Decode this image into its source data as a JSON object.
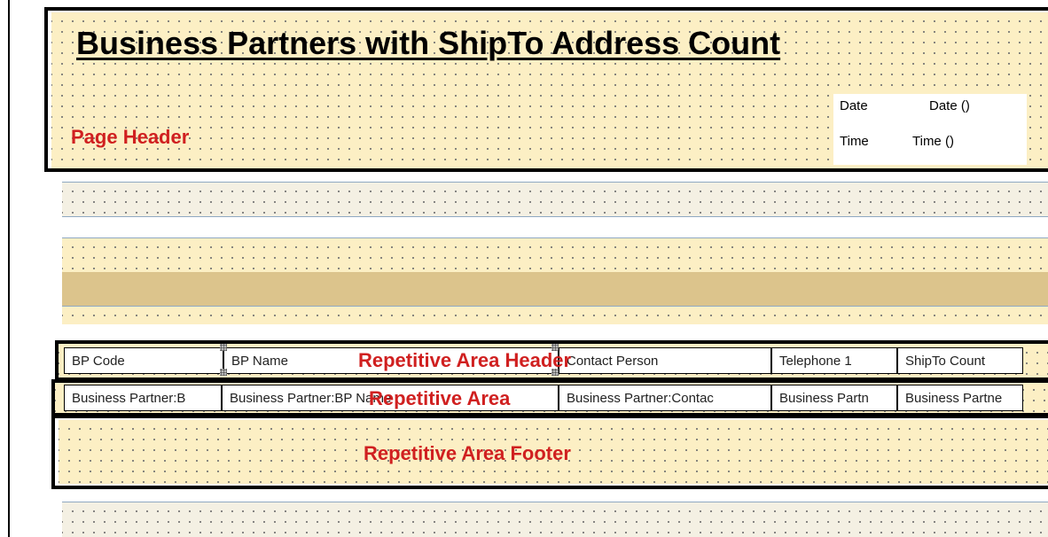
{
  "report": {
    "title": "Business Partners with ShipTo Address Count"
  },
  "page_header": {
    "label": "Page Header",
    "date_label": "Date",
    "date_value": "Date ()",
    "time_label": "Time",
    "time_value": "Time ()"
  },
  "repetitive_area_header": {
    "label": "Repetitive Area Header",
    "columns": [
      "BP Code",
      "BP Name",
      "Contact Person",
      "Telephone 1",
      "ShipTo Count"
    ]
  },
  "repetitive_area": {
    "label": "Repetitive Area",
    "fields": [
      "Business Partner:B",
      "Business Partner:BP Name",
      "Business Partner:Contac",
      "Business Partn",
      "Business Partne"
    ]
  },
  "repetitive_area_footer": {
    "label": "Repetitive Area Footer"
  },
  "colors": {
    "frame": "#000000",
    "label_red": "#d02020",
    "band_yellow": "#fcefc4",
    "band_cream": "#f4f0e3",
    "band_tan": "#dcc48c"
  }
}
